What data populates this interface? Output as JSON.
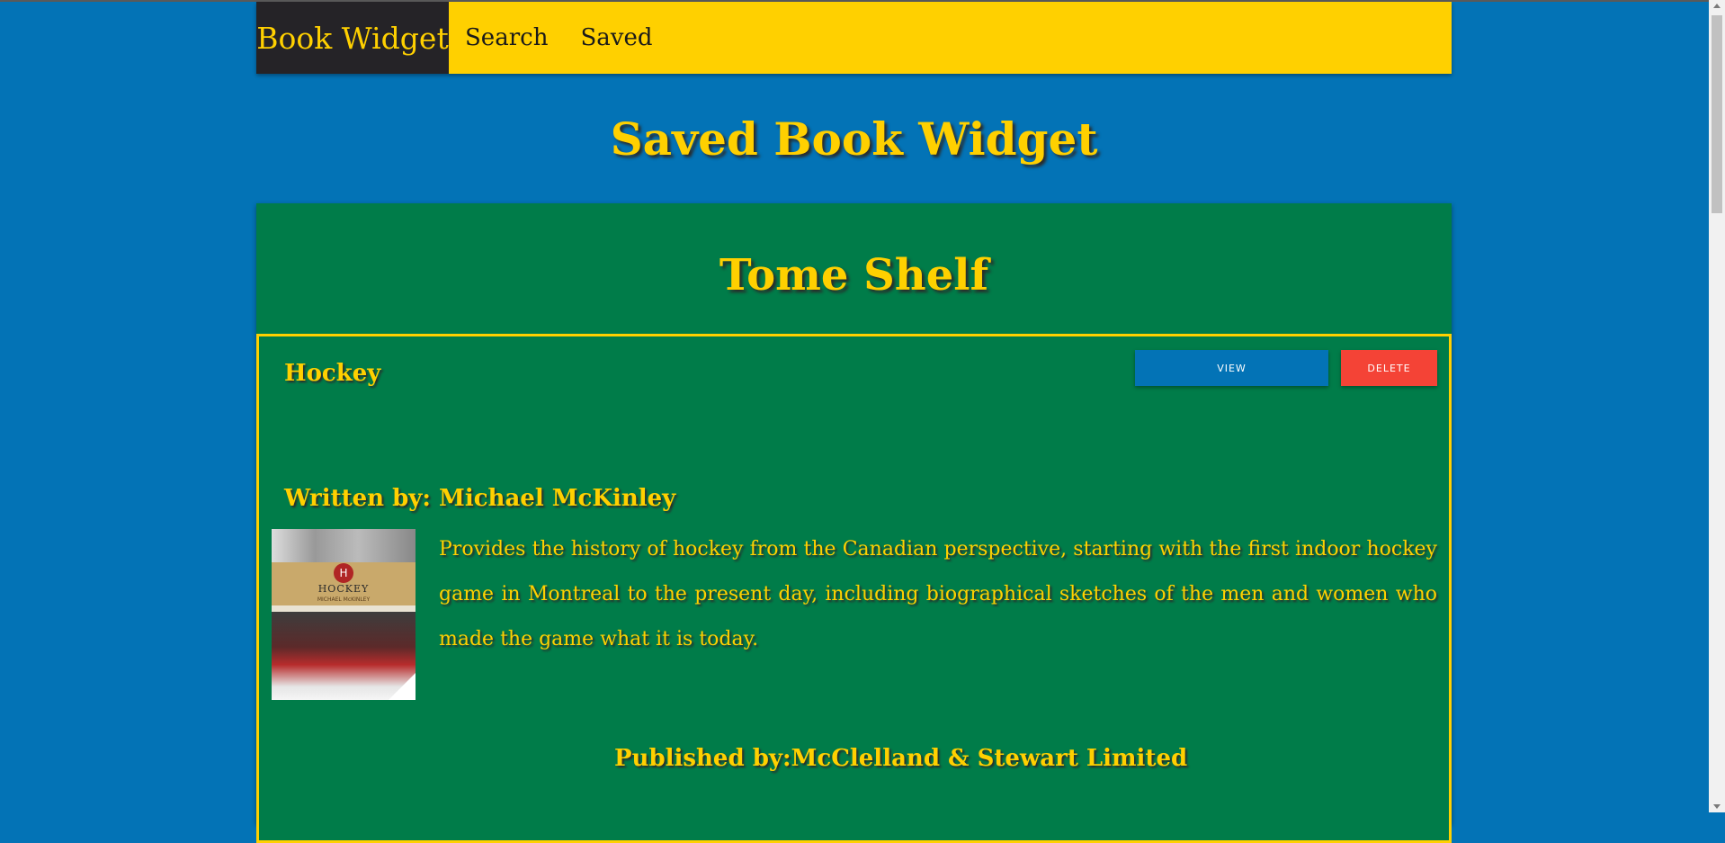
{
  "nav": {
    "brand": "Book Widget",
    "links": [
      {
        "label": "Search"
      },
      {
        "label": "Saved"
      }
    ]
  },
  "page": {
    "title": "Saved Book Widget"
  },
  "panel": {
    "title": "Tome Shelf"
  },
  "books": [
    {
      "title": "Hockey",
      "view_label": "View",
      "delete_label": "Delete",
      "author_line": "Written by: Michael McKinley",
      "cover_alt": "Hockey book cover",
      "cover_title": "HOCKEY",
      "cover_author": "MICHAEL McKINLEY",
      "description": "Provides the history of hockey from the Canadian perspective, starting with the first indoor hockey game in Montreal to the present day, including biographical sketches of the men and women who made the game what it is today.",
      "publisher_line": "Published by:McClelland & Stewart Limited"
    }
  ],
  "colors": {
    "background": "#0373b6",
    "navbar": "#ffd000",
    "brand_bg": "#252327",
    "panel": "#007c49",
    "accent_text": "#ffd000",
    "view_button": "#0373b6",
    "delete_button": "#f44336"
  },
  "icons": {
    "cover_crest": "H"
  }
}
